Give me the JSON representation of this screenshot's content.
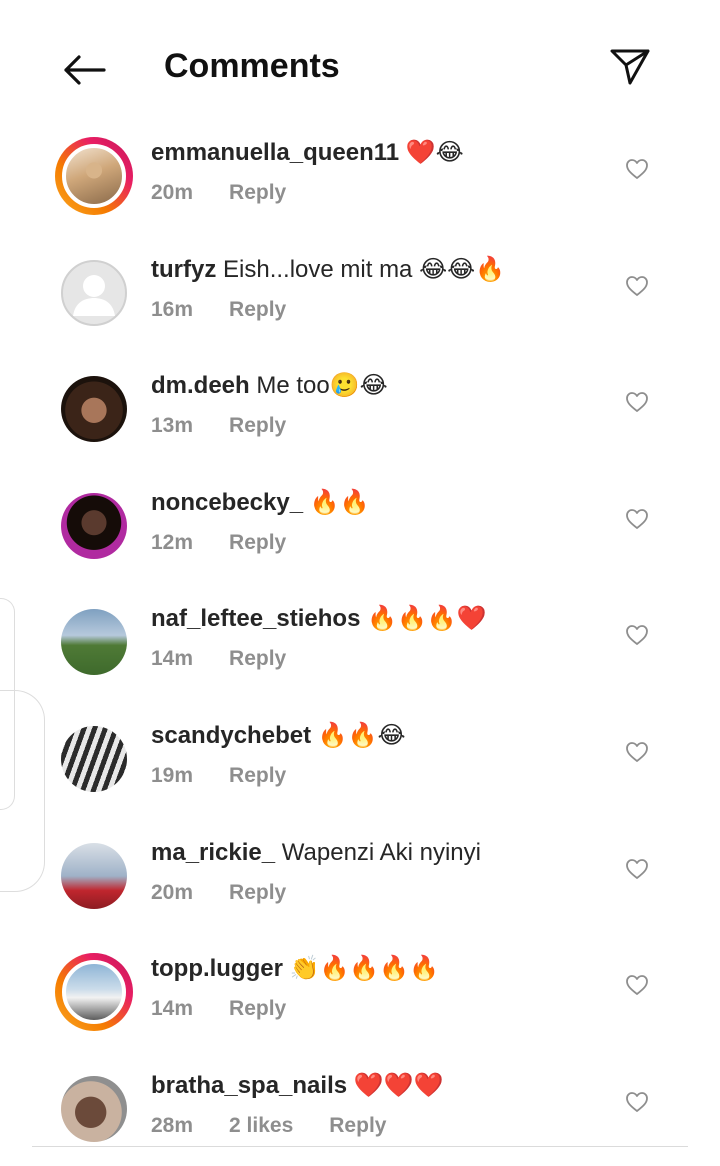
{
  "header": {
    "title": "Comments",
    "back_icon": "arrow-left-icon",
    "share_icon": "paper-plane-icon"
  },
  "comments": [
    {
      "username": "emmanuella_queen11",
      "text": "❤️😂",
      "time": "20m",
      "likes": "",
      "reply": "Reply",
      "story_ring": true,
      "avatar": "avatar-1"
    },
    {
      "username": "turfyz",
      "text": "Eish...love mit ma 😂😂🔥",
      "time": "16m",
      "likes": "",
      "reply": "Reply",
      "story_ring": false,
      "avatar": "default-avatar"
    },
    {
      "username": "dm.deeh",
      "text": "Me too🥲😂",
      "time": "13m",
      "likes": "",
      "reply": "Reply",
      "story_ring": false,
      "avatar": "avatar-3"
    },
    {
      "username": "noncebecky_",
      "text": "🔥🔥",
      "time": "12m",
      "likes": "",
      "reply": "Reply",
      "story_ring": false,
      "avatar": "avatar-4"
    },
    {
      "username": "naf_leftee_stiehos",
      "text": "🔥🔥🔥❤️",
      "time": "14m",
      "likes": "",
      "reply": "Reply",
      "story_ring": false,
      "avatar": "avatar-5"
    },
    {
      "username": "scandychebet",
      "text": "🔥🔥😂",
      "time": "19m",
      "likes": "",
      "reply": "Reply",
      "story_ring": false,
      "avatar": "avatar-6"
    },
    {
      "username": "ma_rickie_",
      "text": "Wapenzi Aki nyinyi",
      "time": "20m",
      "likes": "",
      "reply": "Reply",
      "story_ring": false,
      "avatar": "avatar-7"
    },
    {
      "username": "topp.lugger",
      "text": "👏🔥🔥🔥🔥",
      "time": "14m",
      "likes": "",
      "reply": "Reply",
      "story_ring": true,
      "avatar": "avatar-8"
    },
    {
      "username": "bratha_spa_nails",
      "text": "❤️❤️❤️",
      "time": "28m",
      "likes": "2 likes",
      "reply": "Reply",
      "story_ring": false,
      "avatar": "avatar-9"
    }
  ],
  "colors": {
    "text": "#262626",
    "meta": "#8e8e8e",
    "heart": "#8e8e8e",
    "divider": "#dbdbdb"
  }
}
